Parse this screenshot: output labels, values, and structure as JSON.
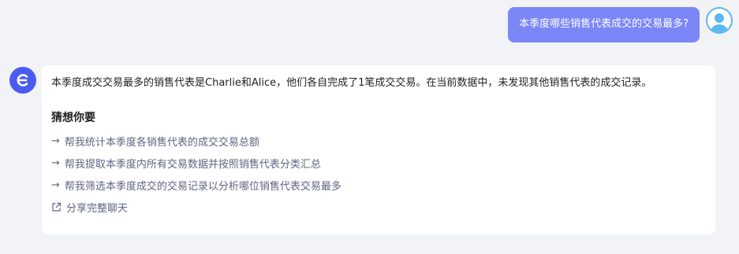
{
  "user_message": {
    "text": "本季度哪些销售代表成交的交易最多?"
  },
  "bot_message": {
    "answer": "本季度成交交易最多的销售代表是Charlie和Alice，他们各自完成了1笔成交交易。在当前数据中，未发现其他销售代表的成交记录。",
    "suggestions_title": "猜想你要",
    "suggestions": [
      {
        "arrow": "→",
        "label": "帮我统计本季度各销售代表的成交交易总额"
      },
      {
        "arrow": "→",
        "label": "帮我提取本季度内所有交易数据并按照销售代表分类汇总"
      },
      {
        "arrow": "→",
        "label": "帮我筛选本季度成交的交易记录以分析哪位销售代表交易最多"
      }
    ],
    "share_label": "分享完整聊天"
  },
  "colors": {
    "background": "#f2f3f7",
    "user_bubble": "#7b86f7",
    "bot_avatar": "#4a5cf0",
    "user_avatar": "#5db8f0",
    "suggestion_text": "#5f6480"
  },
  "icons": {
    "bot_avatar": "bot-logo-icon",
    "user_avatar": "user-avatar-icon",
    "suggestion": "arrow-right-icon",
    "share": "external-share-icon"
  }
}
